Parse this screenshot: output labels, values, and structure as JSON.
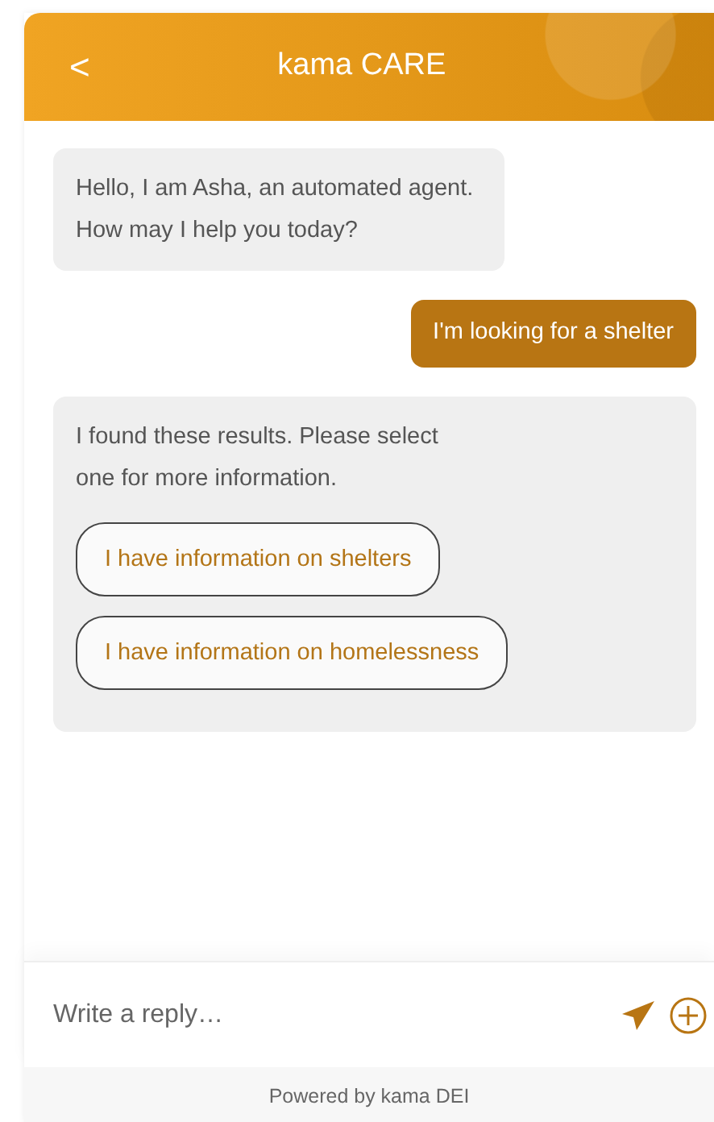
{
  "header": {
    "back": "<",
    "title": "kama CARE"
  },
  "messages": [
    {
      "kind": "bot",
      "text": "Hello, I am Asha, an automated agent. How may I help you today?"
    },
    {
      "kind": "user",
      "text": "I'm looking for a shelter"
    },
    {
      "kind": "bot",
      "text": "I found these results. Please select one for more information.",
      "options": [
        "I have information on shelters",
        "I have information on homelessness"
      ]
    }
  ],
  "composer": {
    "placeholder": "Write a reply…"
  },
  "footer": "Powered by kama DEI"
}
